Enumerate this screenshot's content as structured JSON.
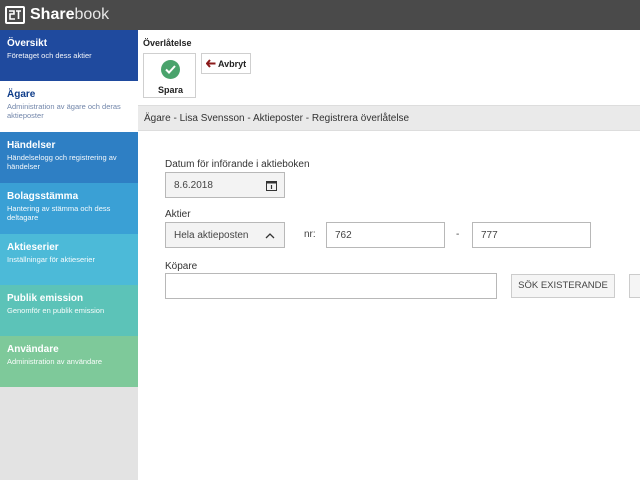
{
  "app": {
    "brand_bold": "Share",
    "brand_light": "book"
  },
  "sidebar": {
    "items": [
      {
        "title": "Översikt",
        "sub": "Företaget och dess aktier",
        "color": "#1f4a9e"
      },
      {
        "title": "Ägare",
        "sub": "Administration av ägare och deras aktieposter",
        "color": "#ffffff"
      },
      {
        "title": "Händelser",
        "sub": "Händelselogg och registrering av händelser",
        "color": "#2e7fc4"
      },
      {
        "title": "Bolagsstämma",
        "sub": "Hantering av stämma och dess deltagare",
        "color": "#3aa0d5"
      },
      {
        "title": "Aktieserier",
        "sub": "Inställningar för aktieserier",
        "color": "#4cbad8"
      },
      {
        "title": "Publik emission",
        "sub": "Genomför en publik emission",
        "color": "#5cc3b8"
      },
      {
        "title": "Användare",
        "sub": "Administration av användare",
        "color": "#7ec99a"
      }
    ]
  },
  "toolbar": {
    "section_label": "Överlåtelse",
    "save_label": "Spara",
    "cancel_label": "Avbryt"
  },
  "page": {
    "title": "Ägare - Lisa Svensson - Aktieposter - Registrera överlåtelse"
  },
  "form": {
    "date_label": "Datum för införande i aktieboken",
    "date_value": "8.6.2018",
    "shares_label": "Aktier",
    "shares_select_value": "Hela aktieposten",
    "nr_label": "nr:",
    "nr_from": "762",
    "nr_separator": "-",
    "nr_to": "777",
    "buyer_label": "Köpare",
    "buyer_value": "",
    "search_existing_label": "SÖK EXISTERANDE"
  },
  "colors": {
    "topbar": "#4a4a4a",
    "save_check": "#4aa36c",
    "cancel_arrow": "#8b1a1a"
  }
}
